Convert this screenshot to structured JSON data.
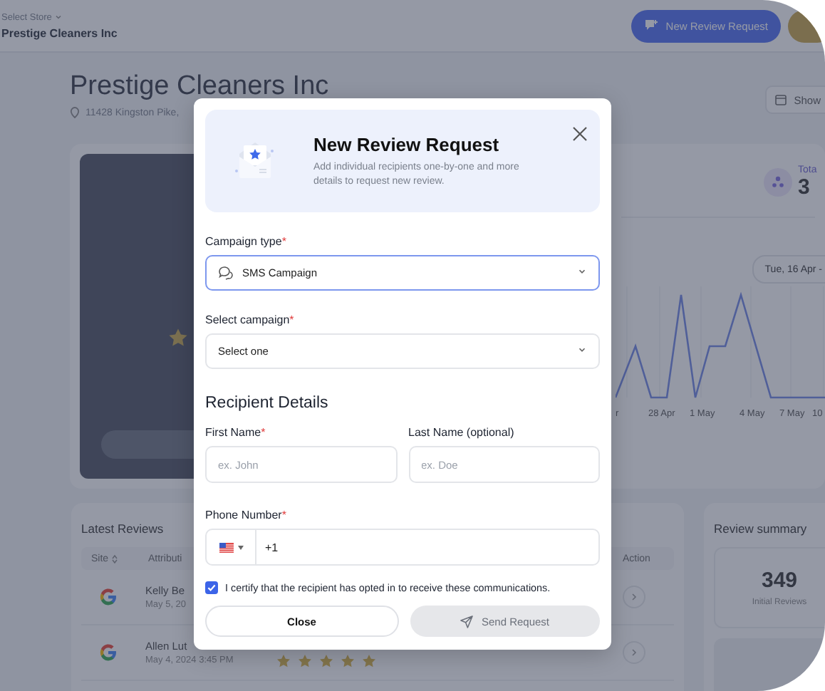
{
  "header": {
    "store_label": "Select Store",
    "store_name": "Prestige Cleaners Inc",
    "new_request_button": "New Review Request"
  },
  "page": {
    "title": "Prestige Cleaners Inc",
    "address": "11428 Kingston Pike,",
    "show_button": "Show"
  },
  "stats": {
    "label": "Tota",
    "value": "3"
  },
  "chart": {
    "date_range": "Tue, 16 Apr -",
    "x_labels": [
      "r",
      "28 Apr",
      "1 May",
      "4 May",
      "7 May",
      "10"
    ]
  },
  "latest_reviews": {
    "title": "Latest Reviews",
    "columns": [
      "Site",
      "Attributi",
      "Action"
    ],
    "rows": [
      {
        "name": "Kelly Be",
        "date": "May 5, 20"
      },
      {
        "name": "Allen Lut",
        "date": "May 4, 2024 3:45 PM",
        "stars": 5
      }
    ]
  },
  "review_summary": {
    "title": "Review summary",
    "value": "349",
    "label": "Initial Reviews"
  },
  "modal": {
    "title": "New Review Request",
    "description": "Add individual recipients one-by-one and more details to request new review.",
    "fields": [
      {
        "kind": "icon_select",
        "label": "Campaign type",
        "required_mark": "*",
        "value": "SMS Campaign",
        "focused": true
      },
      {
        "kind": "select",
        "label": "Select campaign",
        "required_mark": "*",
        "value": "Select one",
        "focused": false
      }
    ],
    "section_title": "Recipient Details",
    "name_fields": [
      {
        "label": "First Name",
        "required_mark": "*",
        "placeholder": "ex. John"
      },
      {
        "label": "Last Name (optional)",
        "placeholder": "ex. Doe"
      }
    ],
    "phone": {
      "label": "Phone Number",
      "required_mark": "*",
      "value": "+1"
    },
    "consent": {
      "label": "I certify that the recipient has opted in to receive these communications.",
      "checked": true
    },
    "buttons": [
      {
        "kind": "outline",
        "label": "Close",
        "disabled": false
      },
      {
        "kind": "send",
        "label": "Send Request",
        "disabled": true
      }
    ]
  }
}
